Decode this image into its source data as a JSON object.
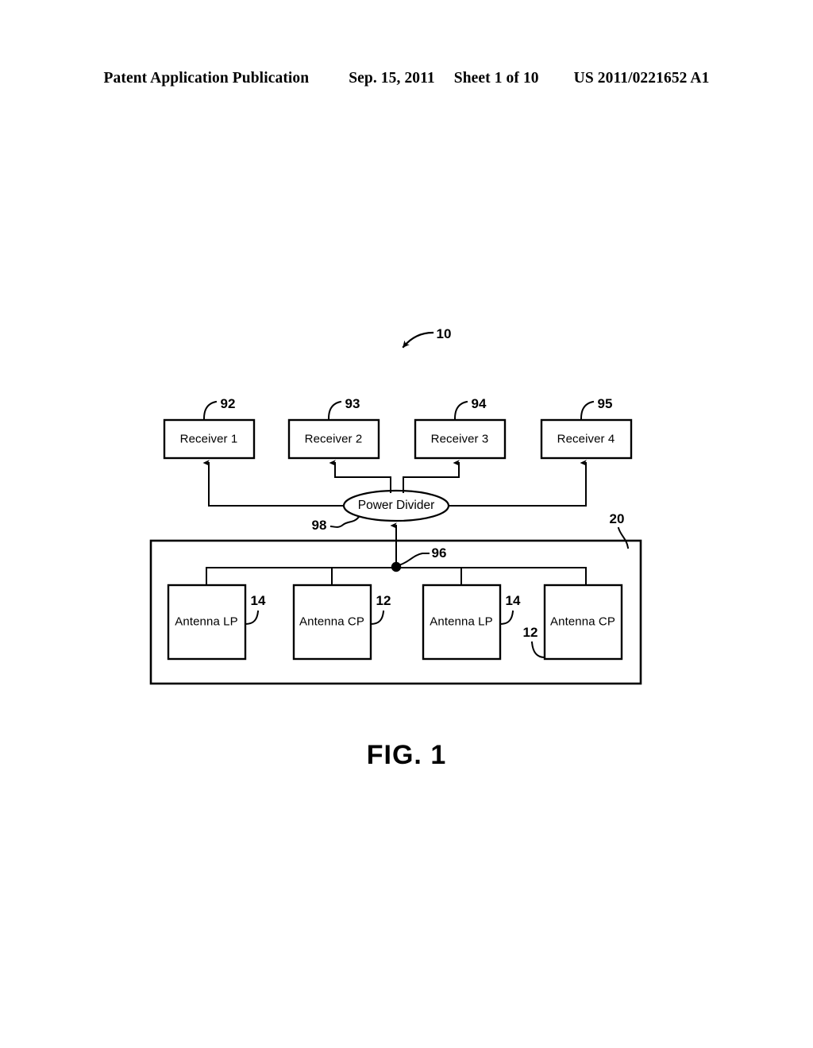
{
  "header": {
    "publication": "Patent Application Publication",
    "date": "Sep. 15, 2011",
    "sheet": "Sheet 1 of 10",
    "patent_number": "US 2011/0221652 A1"
  },
  "figure": {
    "caption": "FIG. 1",
    "system_ref": "10"
  },
  "receivers": [
    {
      "label": "Receiver 1",
      "ref": "92"
    },
    {
      "label": "Receiver 2",
      "ref": "93"
    },
    {
      "label": "Receiver 3",
      "ref": "94"
    },
    {
      "label": "Receiver 4",
      "ref": "95"
    }
  ],
  "power_divider": {
    "label": "Power Divider",
    "ref": "98"
  },
  "feed_network": {
    "junction_ref": "96"
  },
  "antenna_array": {
    "ref": "20",
    "antennas": [
      {
        "label": "Antenna LP",
        "ref": "14"
      },
      {
        "label": "Antenna CP",
        "ref": "12"
      },
      {
        "label": "Antenna LP",
        "ref": "14"
      },
      {
        "label": "Antenna CP",
        "ref": "12"
      }
    ]
  },
  "colors": {
    "ink": "#000000",
    "paper": "#ffffff"
  }
}
